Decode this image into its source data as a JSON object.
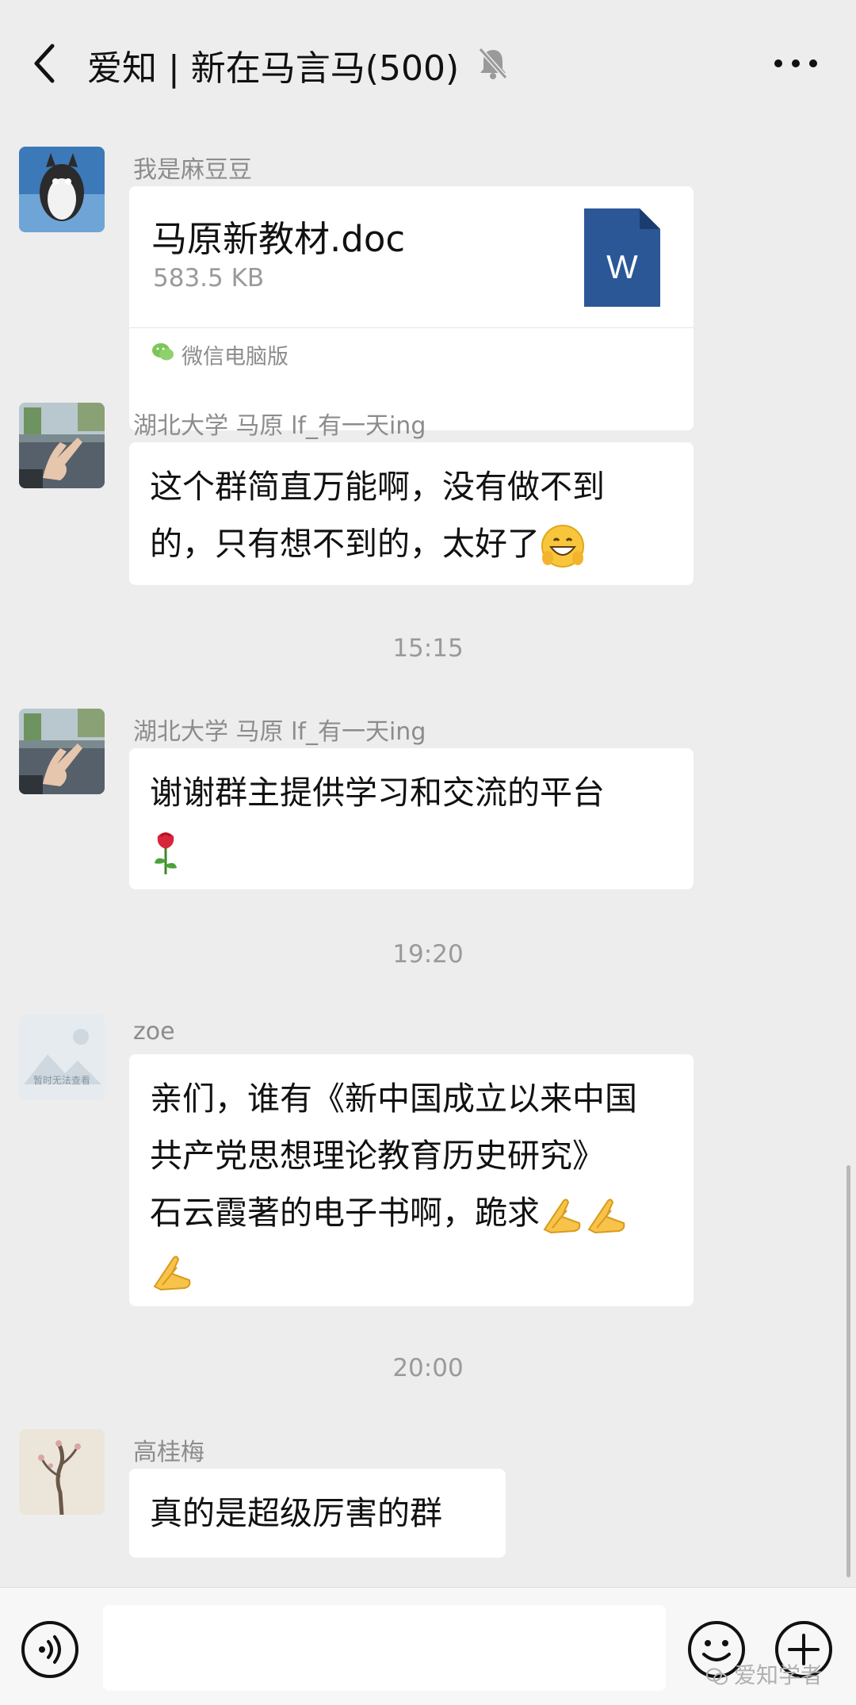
{
  "header": {
    "title": "爱知 | 新在马言马(500)",
    "back_icon": "chevron-left-icon",
    "mute_icon": "bell-muted-icon",
    "more_icon": "more-horizontal-icon"
  },
  "messages": [
    {
      "sender": "我是麻豆豆",
      "type": "file",
      "file_name": "马原新教材.doc",
      "file_size": "583.5 KB",
      "file_source": "微信电脑版",
      "file_icon": "word-doc-icon"
    },
    {
      "sender": "湖北大学 马原 lf_有一天ing",
      "type": "text",
      "lines": [
        "这个群简直万能啊，没有做不到",
        "的，只有想不到的，太好了"
      ],
      "emoji": "grin-emoji-icon"
    },
    {
      "sender": "湖北大学 马原 lf_有一天ing",
      "type": "text",
      "lines": [
        "谢谢群主提供学习和交流的平台"
      ],
      "emoji": "rose-emoji-icon"
    },
    {
      "sender": "zoe",
      "type": "text",
      "lines": [
        "亲们，谁有《新中国成立以来中国",
        "共产党思想理论教育历史研究》",
        "石云霞著的电子书啊，跪求"
      ],
      "emoji": "folded-hands-emoji-icon"
    },
    {
      "sender": "高桂梅",
      "type": "text",
      "lines": [
        "真的是超级厉害的群"
      ]
    }
  ],
  "timestamps": [
    "15:15",
    "19:20",
    "20:00"
  ],
  "avatars": {
    "avatar_3_caption": "暂时无法查看"
  },
  "bottom_bar": {
    "voice_icon": "voice-icon",
    "emoji_icon": "emoji-face-icon",
    "plus_icon": "plus-circle-icon",
    "input_placeholder": ""
  },
  "watermark": "爱知学者",
  "colors": {
    "background": "#ededed",
    "bubble": "#ffffff",
    "word_blue": "#2b5797",
    "meta_text": "#8c8c8c"
  }
}
